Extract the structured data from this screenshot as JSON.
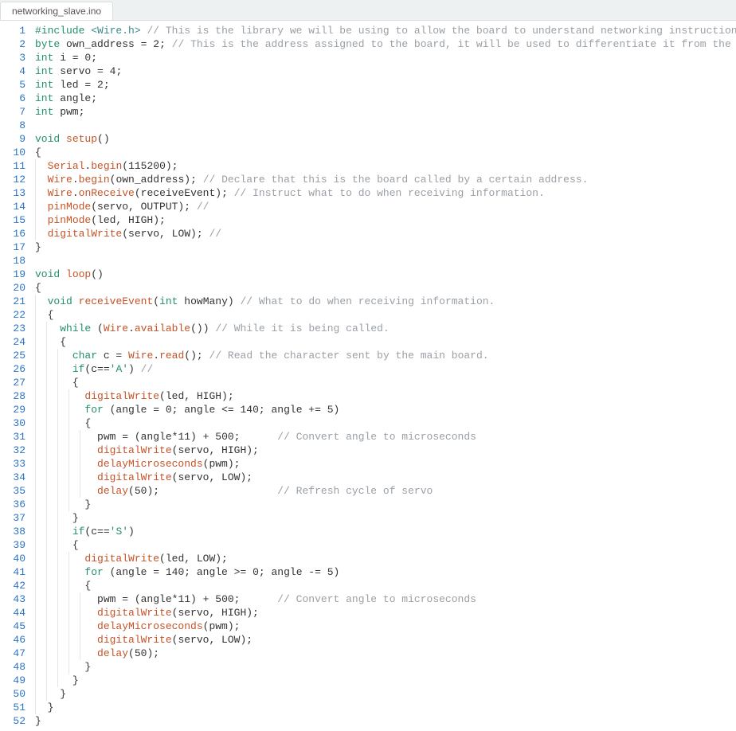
{
  "tab": {
    "name": "networking_slave.ino"
  },
  "code": {
    "lines": [
      {
        "n": 1,
        "indent": 0,
        "tokens": [
          [
            "inc",
            "#include "
          ],
          [
            "lib",
            "<Wire.h>"
          ],
          [
            "op",
            " "
          ],
          [
            "cmt",
            "// This is the library we will be using to allow the board to understand networking instructions."
          ]
        ]
      },
      {
        "n": 2,
        "indent": 0,
        "tokens": [
          [
            "kw",
            "byte"
          ],
          [
            "op",
            " own_address = "
          ],
          [
            "num",
            "2"
          ],
          [
            "op",
            "; "
          ],
          [
            "cmt",
            "// This is the address assigned to the board, it will be used to differentiate it from the other boards."
          ]
        ]
      },
      {
        "n": 3,
        "indent": 0,
        "tokens": [
          [
            "kw",
            "int"
          ],
          [
            "op",
            " i = "
          ],
          [
            "num",
            "0"
          ],
          [
            "op",
            ";"
          ]
        ]
      },
      {
        "n": 4,
        "indent": 0,
        "tokens": [
          [
            "kw",
            "int"
          ],
          [
            "op",
            " servo = "
          ],
          [
            "num",
            "4"
          ],
          [
            "op",
            ";"
          ]
        ]
      },
      {
        "n": 5,
        "indent": 0,
        "tokens": [
          [
            "kw",
            "int"
          ],
          [
            "op",
            " led = "
          ],
          [
            "num",
            "2"
          ],
          [
            "op",
            ";"
          ]
        ]
      },
      {
        "n": 6,
        "indent": 0,
        "tokens": [
          [
            "kw",
            "int"
          ],
          [
            "op",
            " angle;"
          ]
        ]
      },
      {
        "n": 7,
        "indent": 0,
        "tokens": [
          [
            "kw",
            "int"
          ],
          [
            "op",
            " pwm;"
          ]
        ]
      },
      {
        "n": 8,
        "indent": 0,
        "tokens": []
      },
      {
        "n": 9,
        "indent": 0,
        "tokens": [
          [
            "kw",
            "void"
          ],
          [
            "op",
            " "
          ],
          [
            "fn",
            "setup"
          ],
          [
            "op",
            "()"
          ]
        ]
      },
      {
        "n": 10,
        "indent": 0,
        "tokens": [
          [
            "op",
            "{"
          ]
        ]
      },
      {
        "n": 11,
        "indent": 1,
        "tokens": [
          [
            "obj",
            "Serial"
          ],
          [
            "op",
            "."
          ],
          [
            "fn",
            "begin"
          ],
          [
            "op",
            "("
          ],
          [
            "num",
            "115200"
          ],
          [
            "op",
            ");"
          ]
        ]
      },
      {
        "n": 12,
        "indent": 1,
        "tokens": [
          [
            "obj",
            "Wire"
          ],
          [
            "op",
            "."
          ],
          [
            "fn",
            "begin"
          ],
          [
            "op",
            "(own_address); "
          ],
          [
            "cmt",
            "// Declare that this is the board called by a certain address."
          ]
        ]
      },
      {
        "n": 13,
        "indent": 1,
        "tokens": [
          [
            "obj",
            "Wire"
          ],
          [
            "op",
            "."
          ],
          [
            "fn",
            "onReceive"
          ],
          [
            "op",
            "(receiveEvent); "
          ],
          [
            "cmt",
            "// Instruct what to do when receiving information."
          ]
        ]
      },
      {
        "n": 14,
        "indent": 1,
        "tokens": [
          [
            "fn",
            "pinMode"
          ],
          [
            "op",
            "(servo, OUTPUT); "
          ],
          [
            "cmt",
            "//"
          ]
        ]
      },
      {
        "n": 15,
        "indent": 1,
        "tokens": [
          [
            "fn",
            "pinMode"
          ],
          [
            "op",
            "(led, HIGH);"
          ]
        ]
      },
      {
        "n": 16,
        "indent": 1,
        "tokens": [
          [
            "fn",
            "digitalWrite"
          ],
          [
            "op",
            "(servo, LOW); "
          ],
          [
            "cmt",
            "//"
          ]
        ]
      },
      {
        "n": 17,
        "indent": 0,
        "tokens": [
          [
            "op",
            "}"
          ]
        ]
      },
      {
        "n": 18,
        "indent": 0,
        "tokens": []
      },
      {
        "n": 19,
        "indent": 0,
        "tokens": [
          [
            "kw",
            "void"
          ],
          [
            "op",
            " "
          ],
          [
            "fn",
            "loop"
          ],
          [
            "op",
            "()"
          ]
        ]
      },
      {
        "n": 20,
        "indent": 0,
        "tokens": [
          [
            "op",
            "{"
          ]
        ]
      },
      {
        "n": 21,
        "indent": 1,
        "tokens": [
          [
            "kw",
            "void"
          ],
          [
            "op",
            " "
          ],
          [
            "fn",
            "receiveEvent"
          ],
          [
            "op",
            "("
          ],
          [
            "kw",
            "int"
          ],
          [
            "op",
            " howMany) "
          ],
          [
            "cmt",
            "// What to do when receiving information."
          ]
        ]
      },
      {
        "n": 22,
        "indent": 1,
        "tokens": [
          [
            "op",
            "{"
          ]
        ]
      },
      {
        "n": 23,
        "indent": 2,
        "tokens": [
          [
            "kw",
            "while"
          ],
          [
            "op",
            " ("
          ],
          [
            "obj",
            "Wire"
          ],
          [
            "op",
            "."
          ],
          [
            "fn",
            "available"
          ],
          [
            "op",
            "()) "
          ],
          [
            "cmt",
            "// While it is being called."
          ]
        ]
      },
      {
        "n": 24,
        "indent": 2,
        "tokens": [
          [
            "op",
            "{"
          ]
        ]
      },
      {
        "n": 25,
        "indent": 3,
        "tokens": [
          [
            "kw",
            "char"
          ],
          [
            "op",
            " c = "
          ],
          [
            "obj",
            "Wire"
          ],
          [
            "op",
            "."
          ],
          [
            "fn",
            "read"
          ],
          [
            "op",
            "(); "
          ],
          [
            "cmt",
            "// Read the character sent by the main board."
          ]
        ]
      },
      {
        "n": 26,
        "indent": 3,
        "tokens": [
          [
            "kw",
            "if"
          ],
          [
            "op",
            "(c=="
          ],
          [
            "chlit",
            "'A'"
          ],
          [
            "op",
            ") "
          ],
          [
            "cmt",
            "//"
          ]
        ]
      },
      {
        "n": 27,
        "indent": 3,
        "tokens": [
          [
            "op",
            "{"
          ]
        ]
      },
      {
        "n": 28,
        "indent": 4,
        "tokens": [
          [
            "fn",
            "digitalWrite"
          ],
          [
            "op",
            "(led, HIGH);"
          ]
        ]
      },
      {
        "n": 29,
        "indent": 4,
        "tokens": [
          [
            "kw",
            "for"
          ],
          [
            "op",
            " (angle = "
          ],
          [
            "num",
            "0"
          ],
          [
            "op",
            "; angle <= "
          ],
          [
            "num",
            "140"
          ],
          [
            "op",
            "; angle += "
          ],
          [
            "num",
            "5"
          ],
          [
            "op",
            ")"
          ]
        ]
      },
      {
        "n": 30,
        "indent": 4,
        "tokens": [
          [
            "op",
            "{"
          ]
        ]
      },
      {
        "n": 31,
        "indent": 5,
        "tokens": [
          [
            "op",
            "pwm = (angle*"
          ],
          [
            "num",
            "11"
          ],
          [
            "op",
            ") + "
          ],
          [
            "num",
            "500"
          ],
          [
            "op",
            ";      "
          ],
          [
            "cmt",
            "// Convert angle to microseconds"
          ]
        ]
      },
      {
        "n": 32,
        "indent": 5,
        "tokens": [
          [
            "fn",
            "digitalWrite"
          ],
          [
            "op",
            "(servo, HIGH);"
          ]
        ]
      },
      {
        "n": 33,
        "indent": 5,
        "tokens": [
          [
            "fn",
            "delayMicroseconds"
          ],
          [
            "op",
            "(pwm);"
          ]
        ]
      },
      {
        "n": 34,
        "indent": 5,
        "tokens": [
          [
            "fn",
            "digitalWrite"
          ],
          [
            "op",
            "(servo, LOW);"
          ]
        ]
      },
      {
        "n": 35,
        "indent": 5,
        "tokens": [
          [
            "fn",
            "delay"
          ],
          [
            "op",
            "("
          ],
          [
            "num",
            "50"
          ],
          [
            "op",
            ");                   "
          ],
          [
            "cmt",
            "// Refresh cycle of servo"
          ]
        ]
      },
      {
        "n": 36,
        "indent": 4,
        "tokens": [
          [
            "op",
            "}"
          ]
        ]
      },
      {
        "n": 37,
        "indent": 3,
        "tokens": [
          [
            "op",
            "}"
          ]
        ]
      },
      {
        "n": 38,
        "indent": 3,
        "tokens": [
          [
            "kw",
            "if"
          ],
          [
            "op",
            "(c=="
          ],
          [
            "chlit",
            "'S'"
          ],
          [
            "op",
            ")"
          ]
        ]
      },
      {
        "n": 39,
        "indent": 3,
        "tokens": [
          [
            "op",
            "{"
          ]
        ]
      },
      {
        "n": 40,
        "indent": 4,
        "tokens": [
          [
            "fn",
            "digitalWrite"
          ],
          [
            "op",
            "(led, LOW);"
          ]
        ]
      },
      {
        "n": 41,
        "indent": 4,
        "tokens": [
          [
            "kw",
            "for"
          ],
          [
            "op",
            " (angle = "
          ],
          [
            "num",
            "140"
          ],
          [
            "op",
            "; angle >= "
          ],
          [
            "num",
            "0"
          ],
          [
            "op",
            "; angle -= "
          ],
          [
            "num",
            "5"
          ],
          [
            "op",
            ")"
          ]
        ]
      },
      {
        "n": 42,
        "indent": 4,
        "tokens": [
          [
            "op",
            "{"
          ]
        ]
      },
      {
        "n": 43,
        "indent": 5,
        "tokens": [
          [
            "op",
            "pwm = (angle*"
          ],
          [
            "num",
            "11"
          ],
          [
            "op",
            ") + "
          ],
          [
            "num",
            "500"
          ],
          [
            "op",
            ";      "
          ],
          [
            "cmt",
            "// Convert angle to microseconds"
          ]
        ]
      },
      {
        "n": 44,
        "indent": 5,
        "tokens": [
          [
            "fn",
            "digitalWrite"
          ],
          [
            "op",
            "(servo, HIGH);"
          ]
        ]
      },
      {
        "n": 45,
        "indent": 5,
        "tokens": [
          [
            "fn",
            "delayMicroseconds"
          ],
          [
            "op",
            "(pwm);"
          ]
        ]
      },
      {
        "n": 46,
        "indent": 5,
        "tokens": [
          [
            "fn",
            "digitalWrite"
          ],
          [
            "op",
            "(servo, LOW);"
          ]
        ]
      },
      {
        "n": 47,
        "indent": 5,
        "tokens": [
          [
            "fn",
            "delay"
          ],
          [
            "op",
            "("
          ],
          [
            "num",
            "50"
          ],
          [
            "op",
            ");"
          ]
        ]
      },
      {
        "n": 48,
        "indent": 4,
        "tokens": [
          [
            "op",
            "}"
          ]
        ]
      },
      {
        "n": 49,
        "indent": 3,
        "tokens": [
          [
            "op",
            "}"
          ]
        ]
      },
      {
        "n": 50,
        "indent": 2,
        "tokens": [
          [
            "op",
            "}"
          ]
        ]
      },
      {
        "n": 51,
        "indent": 1,
        "tokens": [
          [
            "op",
            "}"
          ]
        ]
      },
      {
        "n": 52,
        "indent": 0,
        "tokens": [
          [
            "op",
            "}"
          ]
        ]
      }
    ]
  }
}
